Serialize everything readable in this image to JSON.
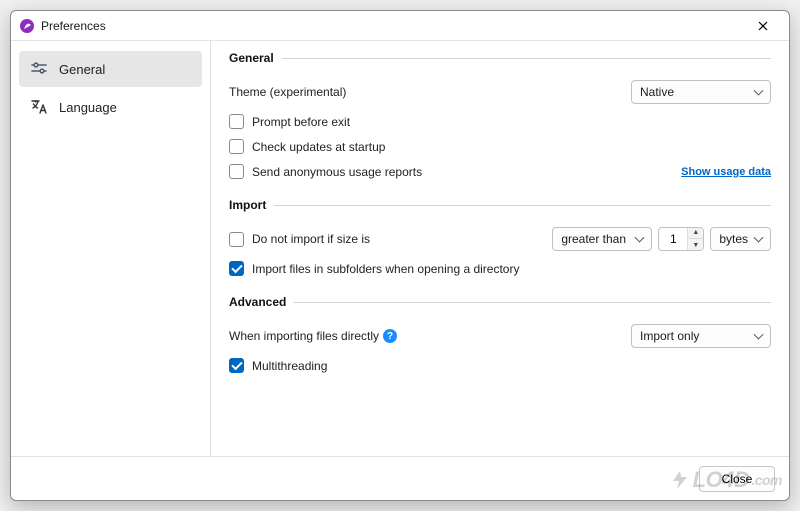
{
  "window": {
    "title": "Preferences"
  },
  "sidebar": {
    "items": [
      {
        "label": "General",
        "selected": true
      },
      {
        "label": "Language",
        "selected": false
      }
    ]
  },
  "sections": {
    "general": {
      "title": "General",
      "theme_label": "Theme (experimental)",
      "theme_value": "Native",
      "prompt_before_exit_label": "Prompt before exit",
      "prompt_before_exit_checked": false,
      "check_updates_label": "Check updates at startup",
      "check_updates_checked": false,
      "send_reports_label": "Send anonymous usage reports",
      "send_reports_checked": false,
      "show_usage_data_link": "Show usage data"
    },
    "import": {
      "title": "Import",
      "do_not_import_label": "Do not import if size is",
      "do_not_import_checked": false,
      "comparator_value": "greater than",
      "size_value": "1",
      "unit_value": "bytes",
      "subfolders_label": "Import files in subfolders when opening a directory",
      "subfolders_checked": true
    },
    "advanced": {
      "title": "Advanced",
      "when_importing_label": "When importing files directly",
      "when_importing_value": "Import only",
      "multithreading_label": "Multithreading",
      "multithreading_checked": true
    }
  },
  "footer": {
    "close_label": "Close"
  },
  "watermark": "LO4D",
  "watermark_suffix": ".com"
}
